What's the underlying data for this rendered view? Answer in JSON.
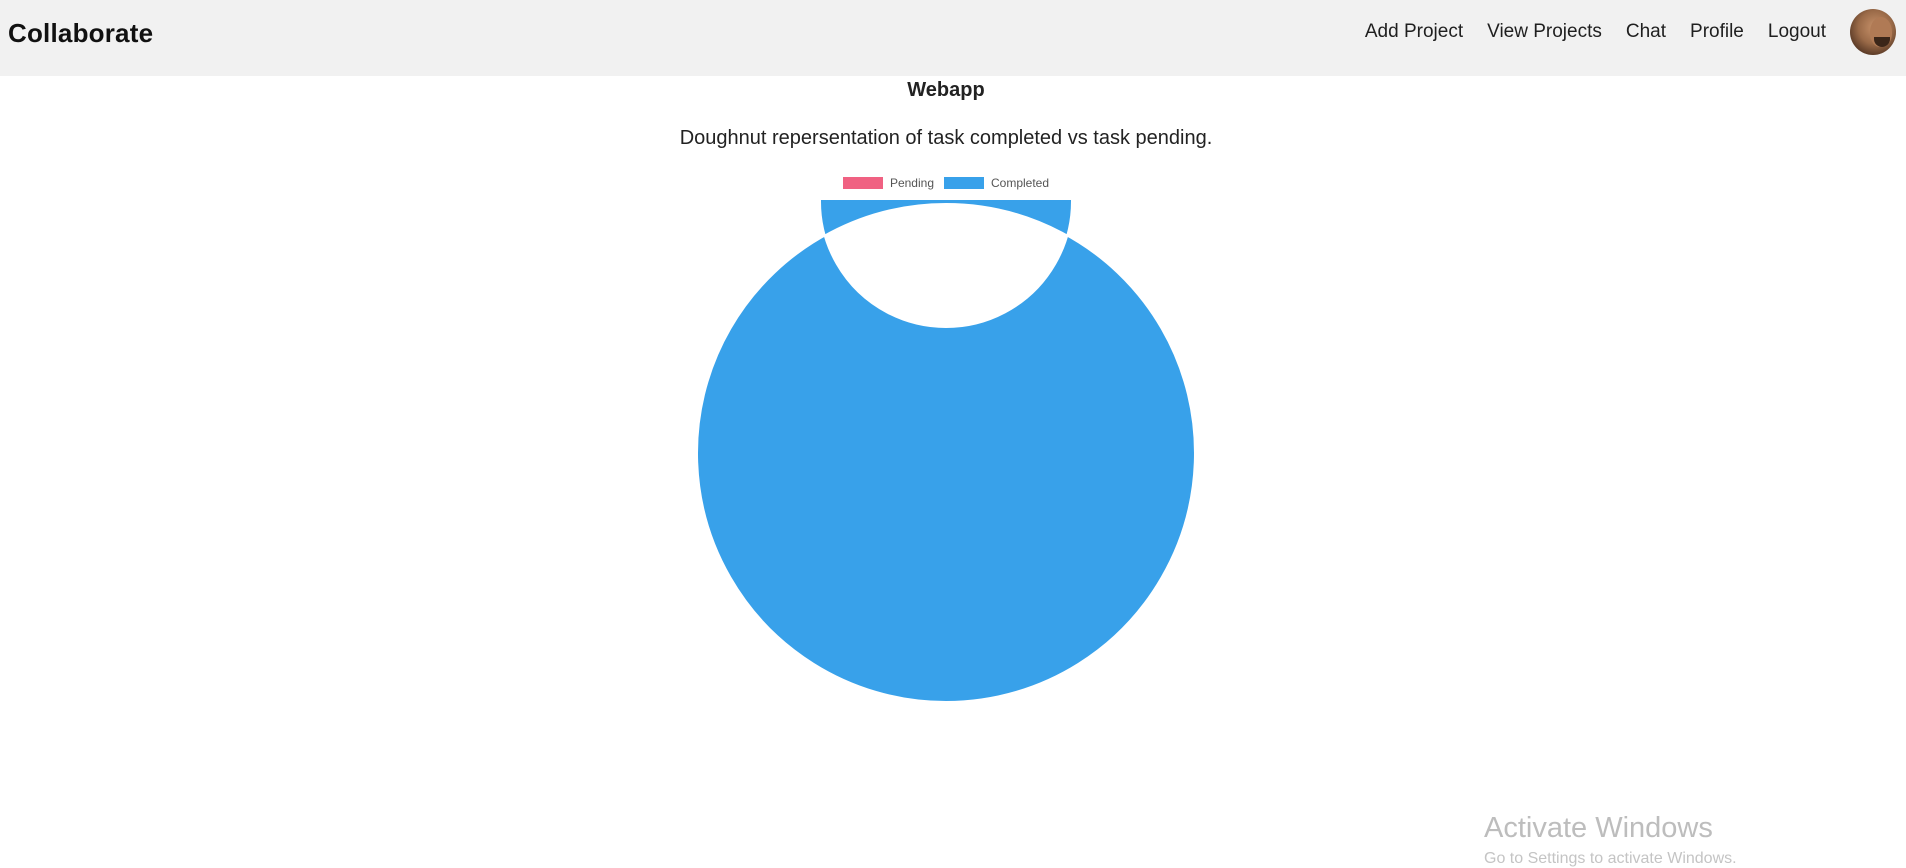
{
  "navbar": {
    "brand": "Collaborate",
    "links": {
      "add_project": "Add Project",
      "view_projects": "View Projects",
      "chat": "Chat",
      "profile": "Profile",
      "logout": "Logout"
    },
    "avatar_icon": "user-avatar"
  },
  "main": {
    "title": "Webapp",
    "subtitle": "Doughnut repersentation of task completed vs task pending."
  },
  "chart_data": {
    "type": "doughnut",
    "categories": [
      "Pending",
      "Completed"
    ],
    "values": [
      0,
      1
    ],
    "colors": [
      "#f06182",
      "#38a1ea"
    ],
    "legend_position": "top"
  },
  "watermark": {
    "title": "Activate Windows",
    "subtitle": "Go to Settings to activate Windows."
  }
}
